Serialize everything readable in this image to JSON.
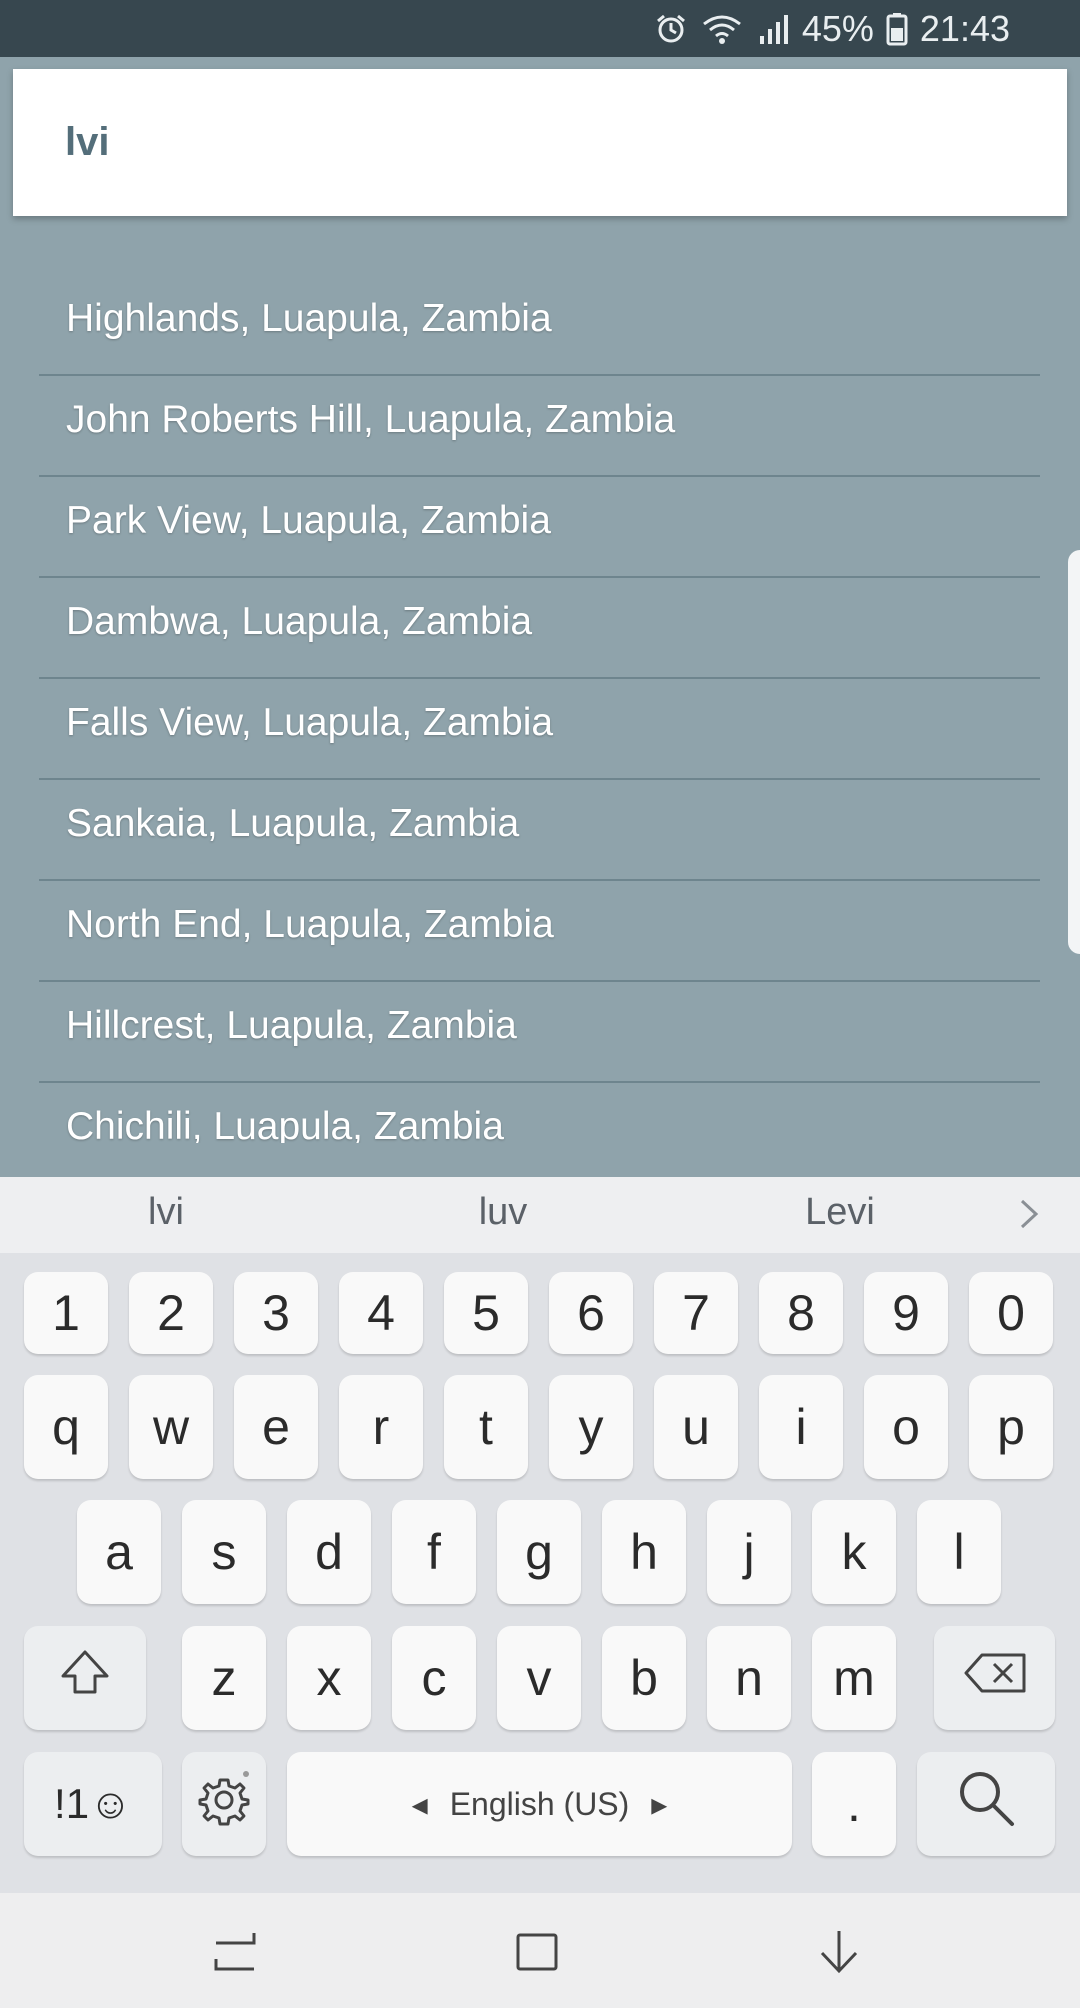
{
  "status_bar": {
    "battery": "45%",
    "time": "21:43",
    "icons": [
      "alarm-icon",
      "wifi-icon",
      "signal-icon",
      "battery-icon"
    ]
  },
  "search": {
    "value": "lvi",
    "placeholder": ""
  },
  "results": [
    "Highlands, Luapula, Zambia",
    "John Roberts Hill, Luapula, Zambia",
    "Park View, Luapula, Zambia",
    "Dambwa, Luapula, Zambia",
    "Falls View, Luapula, Zambia",
    "Sankaia, Luapula, Zambia",
    "North End, Luapula, Zambia",
    "Hillcrest, Luapula, Zambia",
    "Chichili, Luapula, Zambia"
  ],
  "keyboard": {
    "suggestions": [
      "lvi",
      "luv",
      "Levi"
    ],
    "number_row": [
      "1",
      "2",
      "3",
      "4",
      "5",
      "6",
      "7",
      "8",
      "9",
      "0"
    ],
    "row1": [
      "q",
      "w",
      "e",
      "r",
      "t",
      "y",
      "u",
      "i",
      "o",
      "p"
    ],
    "row2": [
      "a",
      "s",
      "d",
      "f",
      "g",
      "h",
      "j",
      "k",
      "l"
    ],
    "row3": [
      "z",
      "x",
      "c",
      "v",
      "b",
      "n",
      "m"
    ],
    "symbols_label": "!1☺",
    "space_label": "English (US)",
    "period_label": "."
  },
  "colors": {
    "status_bar": "#37474f",
    "background": "#8fa3ab",
    "keyboard": "#dfe1e5"
  }
}
